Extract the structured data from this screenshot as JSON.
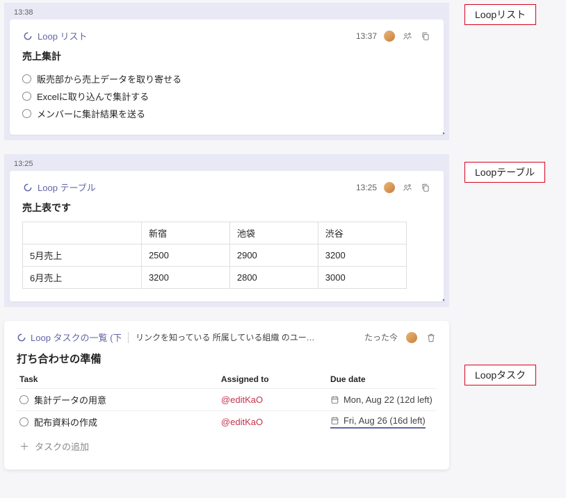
{
  "annotations": {
    "list": "Loopリスト",
    "table": "Loopテーブル",
    "task": "Loopタスク"
  },
  "list_card": {
    "outer_ts": "13:38",
    "loop_label": "Loop リスト",
    "inner_ts": "13:37",
    "title": "売上集計",
    "items": [
      "販売部から売上データを取り寄せる",
      "Excelに取り込んで集計する",
      "メンバーに集計結果を送る"
    ]
  },
  "table_card": {
    "outer_ts": "13:25",
    "loop_label": "Loop テーブル",
    "inner_ts": "13:25",
    "title": "売上表です",
    "columns": [
      "",
      "新宿",
      "池袋",
      "渋谷"
    ],
    "rows": [
      {
        "label": "5月売上",
        "values": [
          "2500",
          "2900",
          "3200"
        ]
      },
      {
        "label": "6月売上",
        "values": [
          "3200",
          "2800",
          "3000"
        ]
      }
    ]
  },
  "task_card": {
    "loop_label": "Loop タスクの一覧 (下書…",
    "perm_text": "リンクを知っている 所属している組織 のユーザーは編集…",
    "right_ts": "たった今",
    "title": "打ち合わせの準備",
    "headers": {
      "task": "Task",
      "assigned": "Assigned to",
      "due": "Due date"
    },
    "tasks": [
      {
        "name": "集計データの用意",
        "assignee": "@editKaO",
        "due": "Mon, Aug 22 (12d left)",
        "accent": false
      },
      {
        "name": "配布資料の作成",
        "assignee": "@editKaO",
        "due": "Fri, Aug 26 (16d left)",
        "accent": true
      }
    ],
    "add_label": "タスクの追加"
  }
}
